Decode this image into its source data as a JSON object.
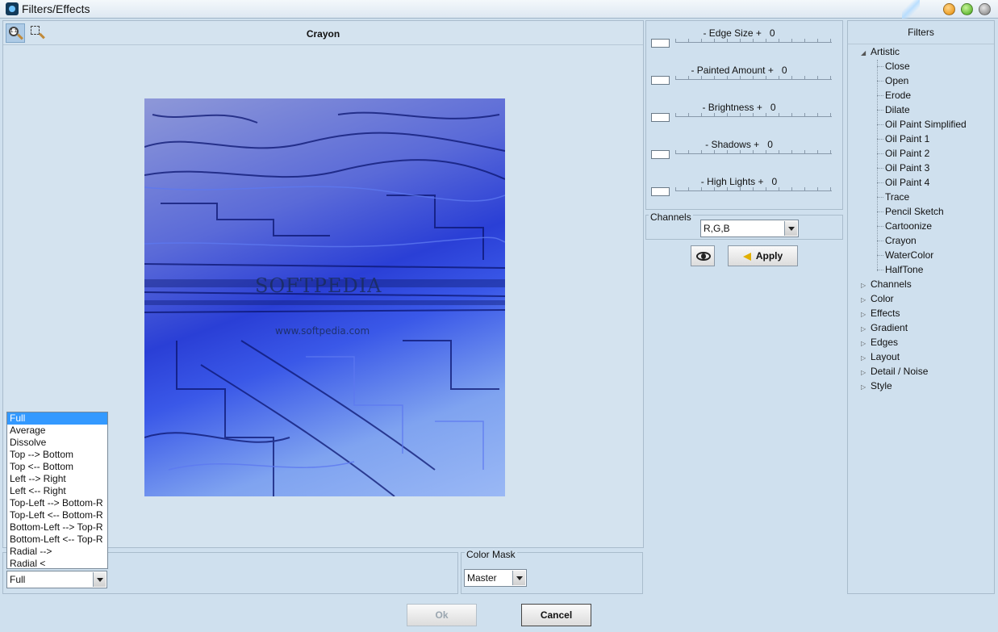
{
  "window": {
    "title": "Filters/Effects"
  },
  "preview": {
    "title": "Crayon",
    "watermark_main": "SOFTPEDIA",
    "watermark_url": "www.softpedia.com"
  },
  "sliders": [
    {
      "label": "- Edge Size +",
      "value": "0"
    },
    {
      "label": "- Painted Amount +",
      "value": "0"
    },
    {
      "label": "- Brightness +",
      "value": "0"
    },
    {
      "label": "- Shadows +",
      "value": "0"
    },
    {
      "label": "- High Lights +",
      "value": "0"
    }
  ],
  "channels": {
    "label": "Channels",
    "value": "R,G,B"
  },
  "apply_label": "Apply",
  "blend": {
    "value": "Full",
    "options": [
      "Full",
      "Average",
      "Dissolve",
      "Top --> Bottom",
      "Top <-- Bottom",
      "Left --> Right",
      "Left <-- Right",
      "Top-Left --> Bottom-R",
      "Top-Left <-- Bottom-R",
      "Bottom-Left --> Top-R",
      "Bottom-Left <-- Top-R",
      "Radial -->",
      "Radial <"
    ]
  },
  "color_mask": {
    "label": "Color Mask",
    "value": "Master"
  },
  "filters": {
    "title": "Filters",
    "artistic": {
      "label": "Artistic",
      "children": [
        "Close",
        "Open",
        "Erode",
        "Dilate",
        "Oil Paint Simplified",
        "Oil Paint 1",
        "Oil Paint 2",
        "Oil Paint 3",
        "Oil Paint 4",
        "Trace",
        "Pencil Sketch",
        "Cartoonize",
        "Crayon",
        "WaterColor",
        "HalfTone"
      ]
    },
    "groups": [
      "Channels",
      "Color",
      "Effects",
      "Gradient",
      "Edges",
      "Layout",
      "Detail / Noise",
      "Style"
    ]
  },
  "footer": {
    "ok_label": "Ok",
    "cancel_label": "Cancel"
  }
}
